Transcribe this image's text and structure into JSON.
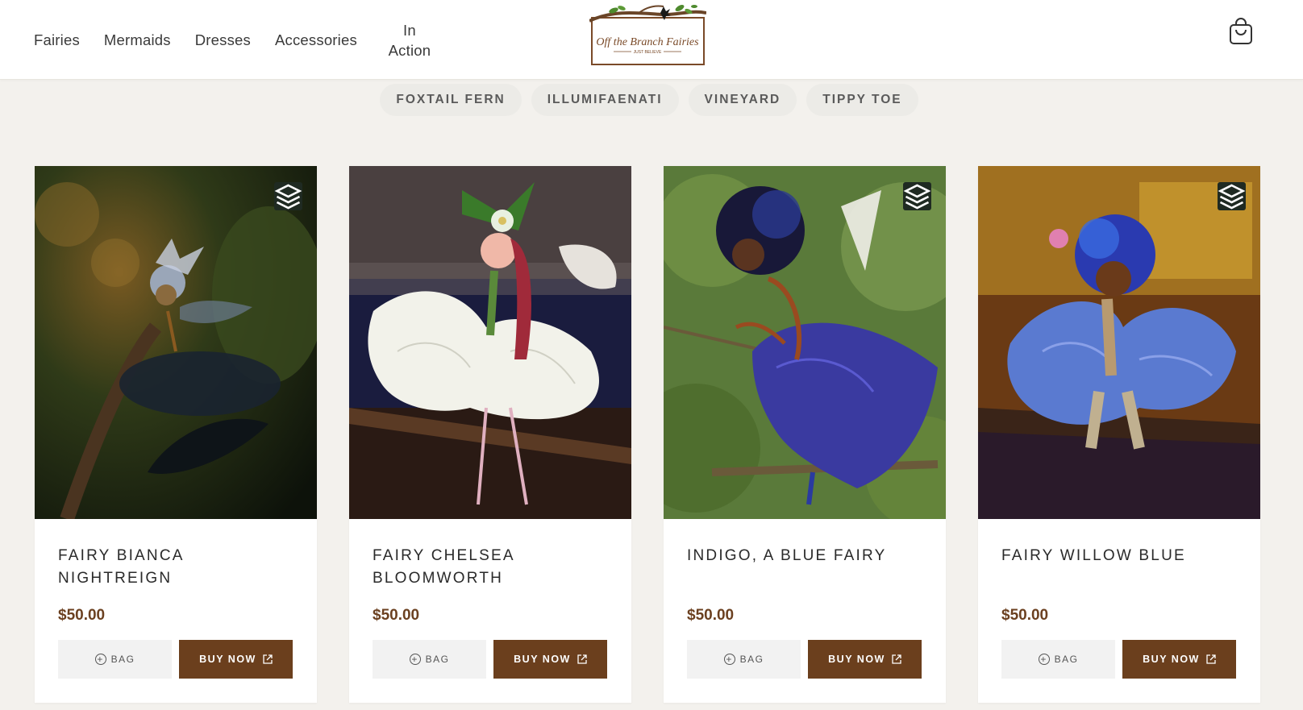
{
  "nav": {
    "items": [
      "Fairies",
      "Mermaids",
      "Dresses",
      "Accessories"
    ],
    "in_action_line1": "In",
    "in_action_line2": "Action"
  },
  "logo": {
    "text": "Off the Branch Fairies",
    "tagline": "JUST BELIEVE"
  },
  "filters": [
    "FOXTAIL FERN",
    "ILLUMIFAENATI",
    "VINEYARD",
    "TIPPY TOE"
  ],
  "products": [
    {
      "title": "Fairy Bianca Nightreign",
      "price": "$50.00",
      "bag_label": "BAG",
      "buy_label": "BUY NOW",
      "has_variants": true
    },
    {
      "title": "Fairy Chelsea Bloomworth",
      "price": "$50.00",
      "bag_label": "BAG",
      "buy_label": "BUY NOW",
      "has_variants": false
    },
    {
      "title": "Indigo, a Blue Fairy",
      "price": "$50.00",
      "bag_label": "BAG",
      "buy_label": "BUY NOW",
      "has_variants": true
    },
    {
      "title": "Fairy Willow Blue",
      "price": "$50.00",
      "bag_label": "BAG",
      "buy_label": "BUY NOW",
      "has_variants": true
    }
  ],
  "colors": {
    "accent_brown": "#6b3f1d",
    "price_brown": "#6b4020",
    "page_bg": "#f3f1ed"
  }
}
